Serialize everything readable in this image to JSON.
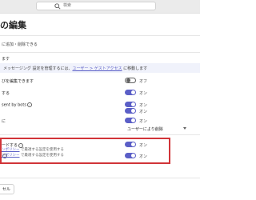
{
  "search": {
    "placeholder": "検索"
  },
  "page": {
    "title": "の編集"
  },
  "header": {
    "subtitle": "に追加・削除できる",
    "field_hint": "ます",
    "info_before": "メッセージング 設定を管理するには、",
    "info_link": "ユーザー > ゲストアクセス",
    "info_after": " に移動します"
  },
  "rows": [
    {
      "label": "びを編集できます",
      "sublabel": "",
      "state": "オフ",
      "on": false
    },
    {
      "label": "する",
      "sublabel": "",
      "state": "オン",
      "on": true
    },
    {
      "label": "sent by bots",
      "sublabel": "",
      "state": "オン",
      "on": true
    },
    {
      "label": "",
      "sublabel": "",
      "state": "オン",
      "on": true
    },
    {
      "label": "に",
      "sublabel": "",
      "state": "オン",
      "on": true
    }
  ],
  "dropdown": {
    "value": "ユーザーにより削除"
  },
  "highlighted_rows": [
    {
      "label": "ードする",
      "link": "ンポリシー",
      "sublabel_after": " で最適する設定を使用する",
      "state": "オン",
      "on": true
    },
    {
      "label": "",
      "link": "ンポリシー",
      "sublabel_after": " で最適する設定を使用する",
      "state": "オン",
      "on": true
    }
  ],
  "footer": {
    "cancel_label": "セル"
  }
}
